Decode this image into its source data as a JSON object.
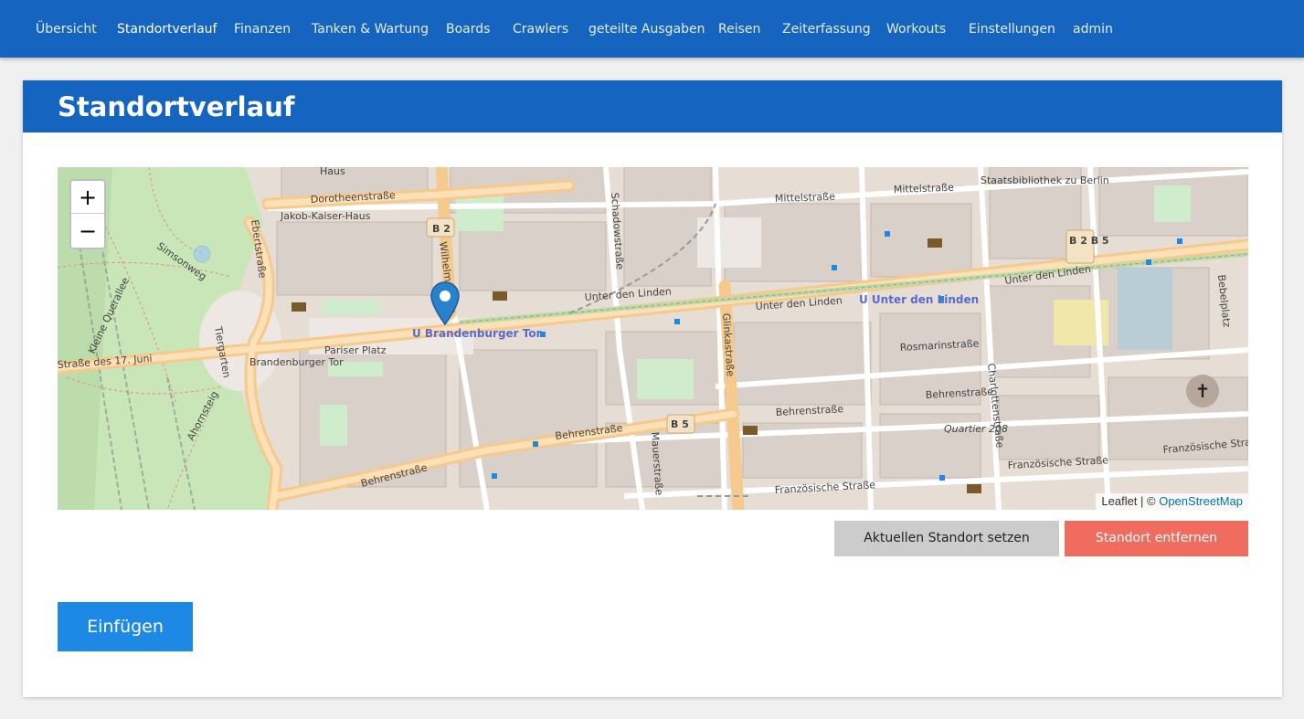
{
  "nav": {
    "items": [
      {
        "label": "Übersicht",
        "active": false
      },
      {
        "label": "Standortverlauf",
        "active": true
      },
      {
        "label": "Finanzen",
        "active": false
      },
      {
        "label": "Tanken & Wartung",
        "active": false
      },
      {
        "label": "Boards",
        "active": false
      },
      {
        "label": "Crawlers",
        "active": false
      },
      {
        "label": "geteilte Ausgaben",
        "active": false
      },
      {
        "label": "Reisen",
        "active": false
      },
      {
        "label": "Zeiterfassung",
        "active": false
      },
      {
        "label": "Workouts",
        "active": false
      },
      {
        "label": "Einstellungen",
        "active": false
      },
      {
        "label": "admin",
        "active": false
      }
    ]
  },
  "page": {
    "title": "Standortverlauf"
  },
  "map": {
    "zoom_in": "+",
    "zoom_out": "−",
    "attribution_prefix": "Leaflet | © ",
    "attribution_link": "OpenStreetMap",
    "marker_icon": "map-pin-icon",
    "labels": {
      "haus": "Haus",
      "dorotheenstrasse": "Dorotheenstraße",
      "jakob_kaiser_haus": "Jakob-Kaiser-Haus",
      "b2_a": "B 2",
      "b2b5": "B 2 B 5",
      "b5": "B 5",
      "mittelstrasse_1": "Mittelstraße",
      "mittelstrasse_2": "Mittelstraße",
      "staatsbibliothek": "Staatsbibliothek zu Berlin",
      "schadowstrasse": "Schadowstraße",
      "unter_den_linden_1": "Unter den Linden",
      "unter_den_linden_2": "Unter den Linden",
      "unter_den_linden_3": "Unter den Linden",
      "u_unter_den_linden": "U Unter den Linden",
      "u_brandenburger_tor": "U Brandenburger Tor",
      "pariser_platz": "Pariser Platz",
      "brandenburger_tor": "Brandenburger Tor",
      "ebertstrasse": "Ebertstraße",
      "simsonweg": "Simsonweg",
      "kleine_querallee": "Kleine Querallee",
      "tiergarten": "Tiergarten",
      "strasse_17_juni": "Straße des 17. Juni",
      "ahornsteig": "Ahornsteig",
      "behrenstrasse_1": "Behrenstraße",
      "behrenstrasse_2": "Behrenstraße",
      "behrenstrasse_3": "Behrenstraße",
      "behrenstrasse_4": "Behrenstraße",
      "glinkastrasse": "Glinkastraße",
      "mauerstrasse": "Mauerstraße",
      "rosmarinstrasse": "Rosmarinstraße",
      "charlottenstrasse": "Charlottenstraße",
      "quartier_208": "Quartier 208",
      "franzoesische_strasse_1": "Französische Straße",
      "franzoesische_strasse_2": "Französische Straße",
      "franzoesische_strasse_3": "Französische Straße",
      "bebelplatz": "Bebelplatz",
      "wilhelmstrasse": "Wilhelmstraße"
    }
  },
  "actions": {
    "set_location": "Aktuellen Standort setzen",
    "remove_location": "Standort entfernen",
    "insert": "Einfügen"
  },
  "colors": {
    "primary": "#1565c0",
    "insert_button": "#1e88e5",
    "remove_button": "#ef6c5f",
    "set_button": "#cccccc",
    "marker": "#2a81cb",
    "road_major": "#fcd6a4",
    "park": "#c8facc"
  }
}
